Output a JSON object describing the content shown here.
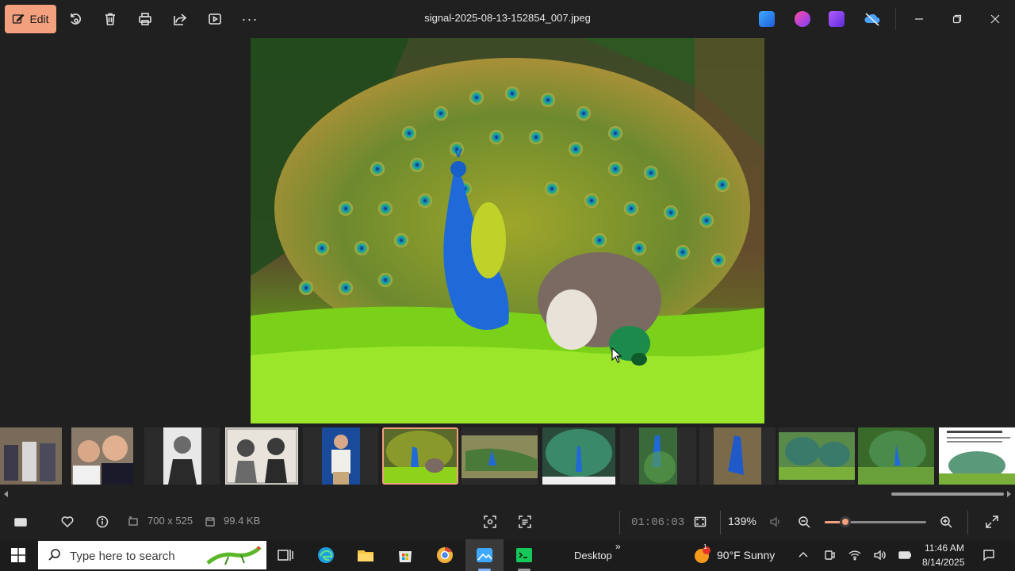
{
  "toolbar": {
    "edit_label": "Edit",
    "file_title": "signal-2025-08-13-152854_007.jpeg",
    "icons": [
      "rotate-icon",
      "delete-icon",
      "print-icon",
      "share-icon",
      "slideshow-icon",
      "more-icon"
    ],
    "more_label": "···"
  },
  "apps": [
    "photos-editor-icon",
    "clipchamp-icon",
    "video-editor-icon",
    "onedrive-offline-icon"
  ],
  "filmstrip": {
    "selected_index": 5,
    "thumbs": [
      "group-photo",
      "two-men-photo",
      "man-suit-bw",
      "two-portraits-bw",
      "man-blue-bg",
      "peacock-peahen",
      "peacock-ground",
      "peacock-display",
      "peacock-close",
      "peacock-blue",
      "peacocks-field",
      "peacock-garden",
      "peacock-article"
    ]
  },
  "status": {
    "dimensions": "700 x 525",
    "file_size": "99.4 KB",
    "overlay_time": "01:06:03",
    "zoom": "139%",
    "zoom_fraction": 0.2
  },
  "taskbar": {
    "search_placeholder": "Type here to search",
    "desktop_label": "Desktop",
    "chevron": "»",
    "weather": "90°F  Sunny",
    "weather_badge": "1",
    "time": "11:46 AM",
    "date": "8/14/2025"
  },
  "colors": {
    "accent": "#f3a07f",
    "background": "#202020"
  }
}
